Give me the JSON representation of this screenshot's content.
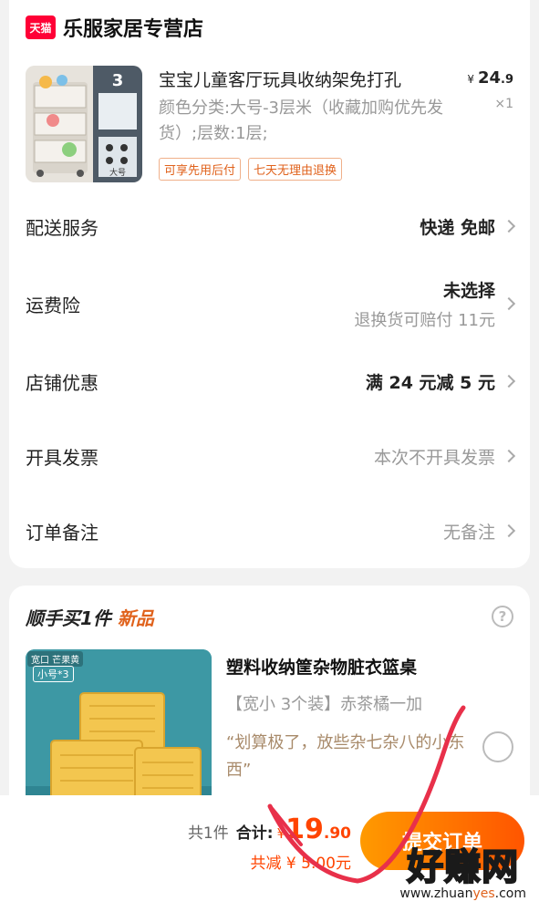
{
  "shop": {
    "badge": "天猫",
    "name": "乐服家居专营店"
  },
  "product": {
    "title": "宝宝儿童客厅玩具收纳架免打孔",
    "sku": "颜色分类:大号-3层米（收藏加购优先发货）;层数:1层;",
    "price_currency": "¥",
    "price_int": "24",
    "price_dec": ".9",
    "quantity": "×1",
    "tags": [
      "可享先用后付",
      "七天无理由退换"
    ],
    "image_labels": {
      "layers": "3",
      "size": "大号"
    }
  },
  "rows": {
    "delivery": {
      "label": "配送服务",
      "value": "快递 免邮"
    },
    "insurance": {
      "label": "运费险",
      "value": "未选择",
      "sub": "退换货可赔付 11元"
    },
    "coupon": {
      "label": "店铺优惠",
      "value": "满 24 元减 5 元"
    },
    "invoice": {
      "label": "开具发票",
      "value": "本次不开具发票"
    },
    "note": {
      "label": "订单备注",
      "value": "无备注"
    }
  },
  "recommend": {
    "heading_prefix": "顺手买1件",
    "heading_new": "新品",
    "help": "?",
    "badge_top": "宽口 芒果黄",
    "badge": "小号*3",
    "title": "塑料收纳筐杂物脏衣篮桌",
    "spec": "【宽小 3个装】赤茶橘一加",
    "quote": "“划算极了，放些杂七杂八的小东西”"
  },
  "bottom": {
    "count": "共1件",
    "total_label": "合计:",
    "total_currency": "¥",
    "total_int": "19",
    "total_dec": ".90",
    "discount": "共减 ¥ 5.00元",
    "submit": "提交订单"
  },
  "watermark": {
    "main": "好赚网",
    "sub_pre": "www.zhuan",
    "sub_hl": "yes",
    "sub_post": ".com"
  },
  "colors": {
    "accent": "#ff4400",
    "tmall": "#ff0036",
    "scribble": "#e8304a"
  }
}
